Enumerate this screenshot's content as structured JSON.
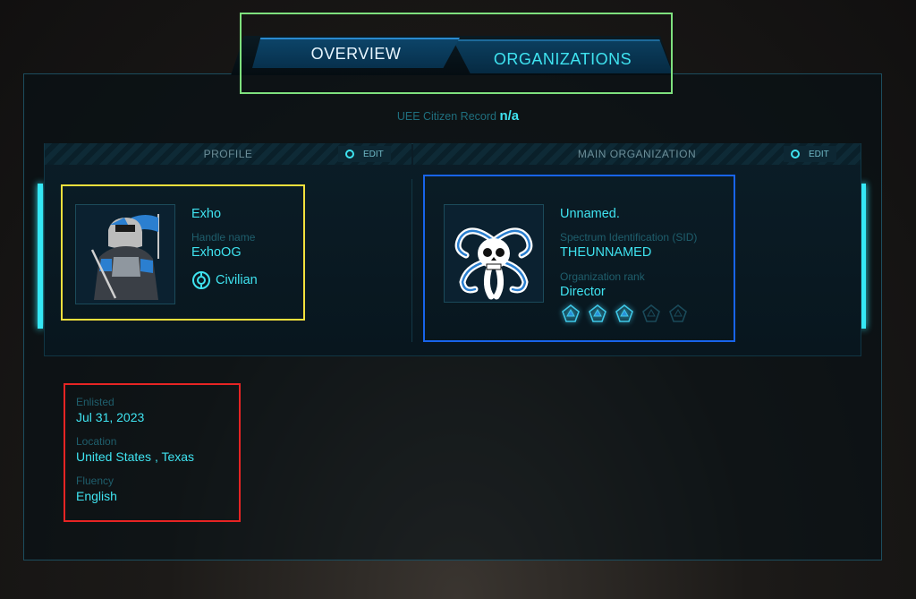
{
  "tabs": [
    {
      "label": "OVERVIEW",
      "active": true
    },
    {
      "label": "ORGANIZATIONS",
      "active": false
    }
  ],
  "citizen_record": {
    "label": "UEE Citizen Record",
    "value": "n/a"
  },
  "profile": {
    "section_title": "PROFILE",
    "edit_label": "EDIT",
    "name": "Exho",
    "handle_label": "Handle name",
    "handle": "ExhoOG",
    "role_icon": "civilian-badge-icon",
    "role": "Civilian"
  },
  "main_org": {
    "section_title": "MAIN ORGANIZATION",
    "edit_label": "EDIT",
    "name": "Unnamed.",
    "sid_label": "Spectrum Identification (SID)",
    "sid": "THEUNNAMED",
    "rank_label": "Organization rank",
    "rank": "Director",
    "rank_stars_filled": 3,
    "rank_stars_total": 5
  },
  "details": {
    "enlisted_label": "Enlisted",
    "enlisted": "Jul 31, 2023",
    "location_label": "Location",
    "location": "United States , Texas",
    "fluency_label": "Fluency",
    "fluency": "English"
  },
  "colors": {
    "accent": "#3fe3f0",
    "label": "#1f5f6d",
    "highlight_tabs": "#7ee07e",
    "highlight_profile": "#f3e03c",
    "highlight_org": "#1864ea",
    "highlight_details": "#e62424"
  }
}
